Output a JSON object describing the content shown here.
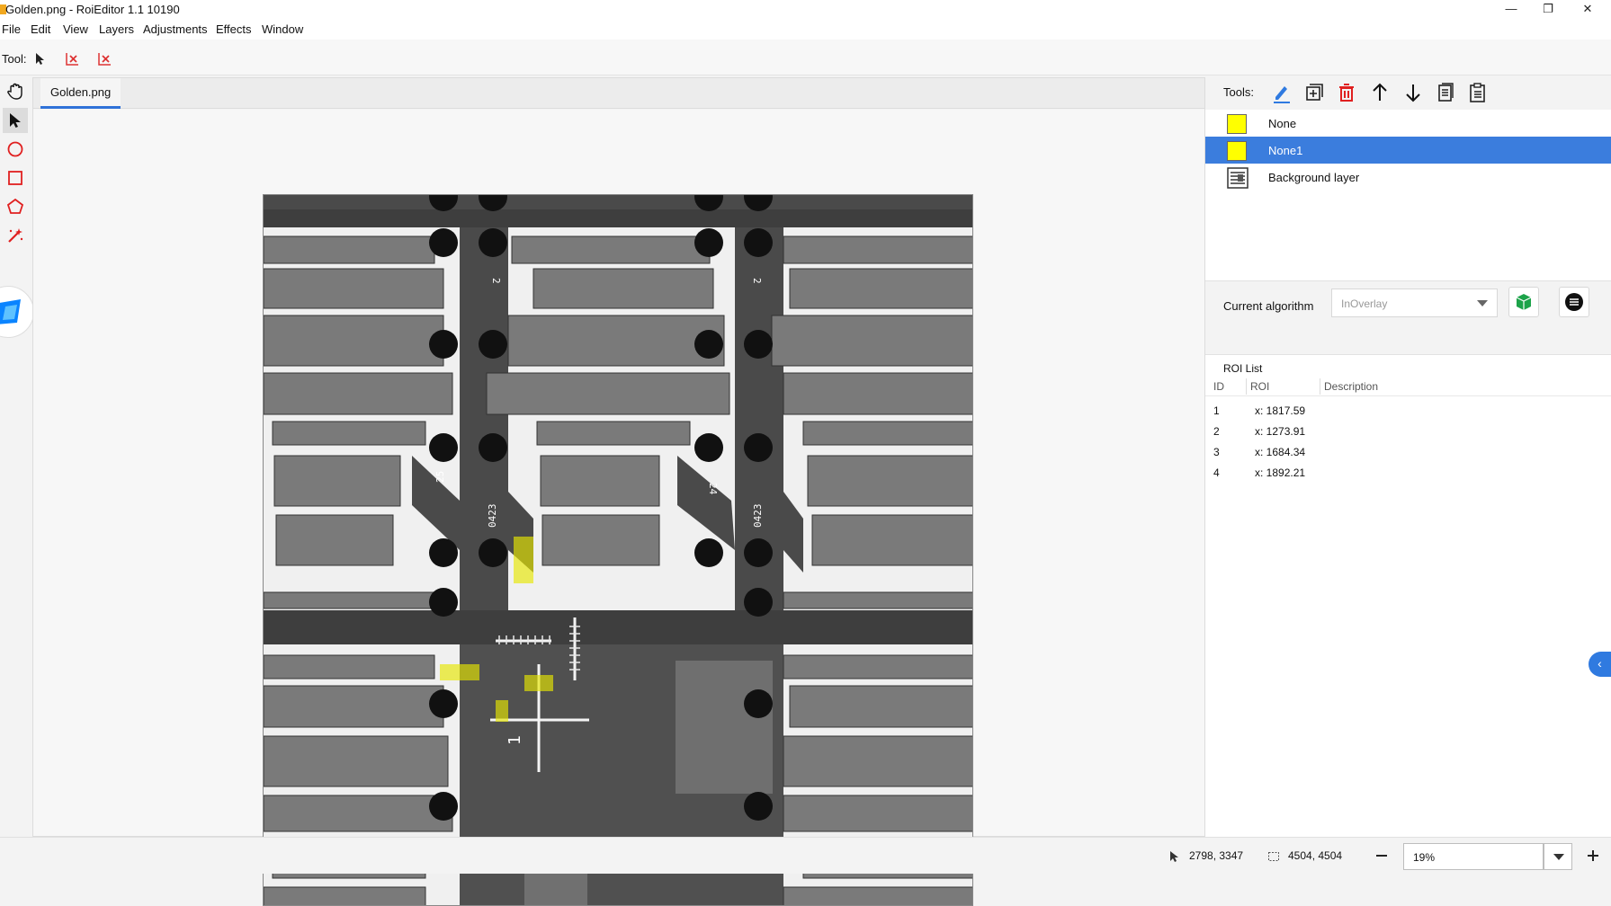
{
  "window": {
    "title": "Golden.png - RoiEditor 1.1 10190"
  },
  "menu": [
    "File",
    "Edit",
    "View",
    "Layers",
    "Adjustments",
    "Effects",
    "Window"
  ],
  "toolbar": {
    "label": "Tool:"
  },
  "document": {
    "tab": "Golden.png"
  },
  "right_panel": {
    "tools_label": "Tools:",
    "layers": [
      {
        "name": "None",
        "color": "#ffff00",
        "selected": false
      },
      {
        "name": "None1",
        "color": "#ffff00",
        "selected": true
      },
      {
        "name": "Background layer",
        "icon": "background-layer-icon",
        "selected": false
      }
    ],
    "algorithm_label": "Current algorithm",
    "algorithm_value": "InOverlay",
    "roi_list_title": "ROI List",
    "roi_columns": [
      "ID",
      "ROI",
      "Description"
    ],
    "roi_rows": [
      {
        "id": "1",
        "roi": "x: 1817.59"
      },
      {
        "id": "2",
        "roi": "x: 1273.91"
      },
      {
        "id": "3",
        "roi": "x: 1684.34"
      },
      {
        "id": "4",
        "roi": "x: 1892.21"
      }
    ]
  },
  "status": {
    "cursor": "2798, 3347",
    "size": "4504, 4504",
    "zoom": "19%"
  },
  "image_labels": [
    "2",
    "2",
    "25",
    "24",
    "0423",
    "0423",
    "1"
  ],
  "colors": {
    "accent": "#3b7ddd",
    "roi_fill": "#e6e600"
  }
}
